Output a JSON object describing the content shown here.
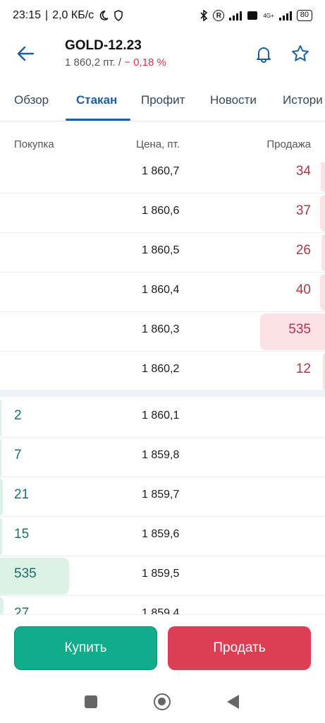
{
  "status": {
    "time": "23:15",
    "separator": "|",
    "speed": "2,0 КБ/с",
    "net_label": "4G+",
    "battery": "80"
  },
  "header": {
    "title": "GOLD-12.23",
    "price": "1 860,2 пт. /",
    "change": "− 0,18 %"
  },
  "tabs": [
    {
      "label": "Обзор"
    },
    {
      "label": "Стакан"
    },
    {
      "label": "Профит"
    },
    {
      "label": "Новости"
    },
    {
      "label": "Истори"
    }
  ],
  "active_tab": "Стакан",
  "columns": {
    "buy": "Покупка",
    "price": "Цена, пт.",
    "sell": "Продажа"
  },
  "asks": [
    {
      "price": "1 860,7",
      "qty": "34"
    },
    {
      "price": "1 860,6",
      "qty": "37"
    },
    {
      "price": "1 860,5",
      "qty": "26"
    },
    {
      "price": "1 860,4",
      "qty": "40"
    },
    {
      "price": "1 860,3",
      "qty": "535"
    },
    {
      "price": "1 860,2",
      "qty": "12"
    }
  ],
  "bids": [
    {
      "price": "1 860,1",
      "qty": "2"
    },
    {
      "price": "1 859,8",
      "qty": "7"
    },
    {
      "price": "1 859,7",
      "qty": "21"
    },
    {
      "price": "1 859,6",
      "qty": "15"
    },
    {
      "price": "1 859,5",
      "qty": "535"
    },
    {
      "price": "1 859,4",
      "qty": "27"
    }
  ],
  "actions": {
    "buy": "Купить",
    "sell": "Продать"
  },
  "colors": {
    "accent": "#1c5fa0",
    "buy": "#10ac8c",
    "sell": "#dc3e54",
    "ask_text": "#b0354a",
    "bid_text": "#1b6f6a"
  },
  "icons": {
    "back": "arrow-left-icon",
    "bell": "bell-icon",
    "star": "star-icon"
  }
}
